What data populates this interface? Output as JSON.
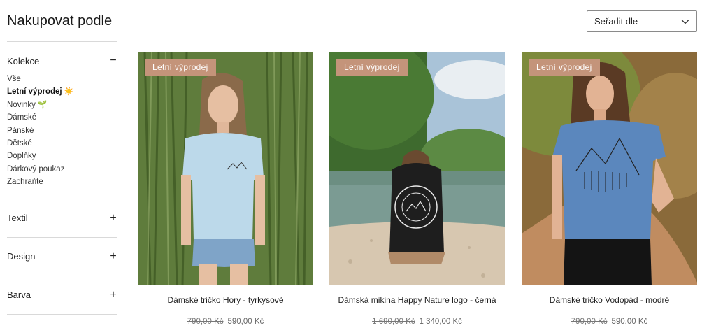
{
  "sidebar": {
    "title": "Nakupovat podle",
    "facets": [
      {
        "label": "Kolekce",
        "toggle": "−",
        "expanded": true
      },
      {
        "label": "Textil",
        "toggle": "+"
      },
      {
        "label": "Design",
        "toggle": "+"
      },
      {
        "label": "Barva",
        "toggle": "+"
      }
    ],
    "collections": [
      {
        "label": "Vše"
      },
      {
        "label": "Letní výprodej",
        "emoji": "☀️",
        "active": true
      },
      {
        "label": "Novinky",
        "emoji": "🌱"
      },
      {
        "label": "Dámské"
      },
      {
        "label": "Pánské"
      },
      {
        "label": "Dětské"
      },
      {
        "label": "Doplňky"
      },
      {
        "label": "Dárkový poukaz"
      },
      {
        "label": "Zachraňte"
      }
    ]
  },
  "sort": {
    "label": "Seřadit dle",
    "icon": "chevron-down-icon"
  },
  "products": [
    {
      "badge": "Letní výprodej",
      "name": "Dámské tričko Hory - tyrkysové",
      "old_price": "790,00 Kč",
      "price": "590,00 Kč"
    },
    {
      "badge": "Letní výprodej",
      "name": "Dámská mikina Happy Nature logo - černá",
      "old_price": "1 690,00 Kč",
      "price": "1 340,00 Kč"
    },
    {
      "badge": "Letní výprodej",
      "name": "Dámské tričko Vodopád - modré",
      "old_price": "790,00 Kč",
      "price": "590,00 Kč"
    }
  ],
  "colors": {
    "badge": "#c4947a",
    "divider": "#d9d9d9",
    "text": "#222222"
  }
}
